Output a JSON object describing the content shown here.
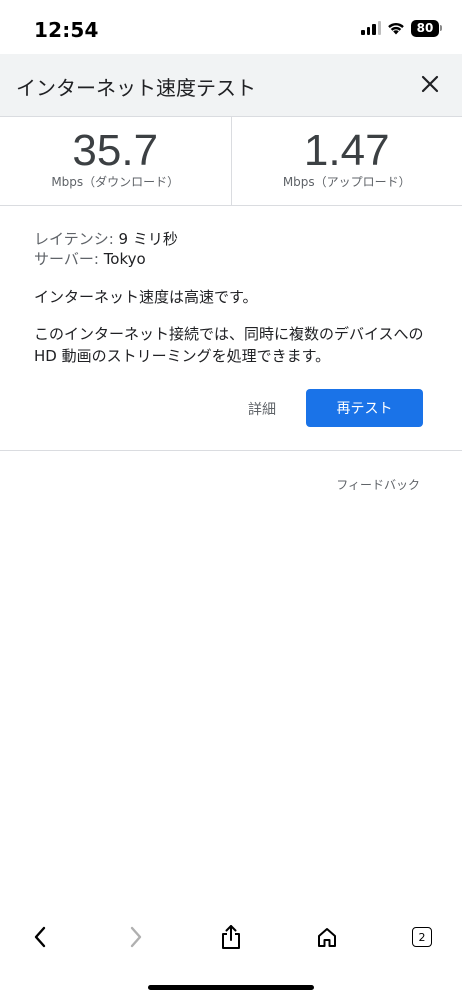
{
  "status_bar": {
    "time": "12:54",
    "battery": "80"
  },
  "header": {
    "title": "インターネット速度テスト",
    "close_icon": "close-icon"
  },
  "speed": {
    "download": {
      "value": "35.7",
      "label": "Mbps（ダウンロード）"
    },
    "upload": {
      "value": "1.47",
      "label": "Mbps（アップロード）"
    }
  },
  "info": {
    "latency_label": "レイテンシ:",
    "latency_value": "9 ミリ秒",
    "server_label": "サーバー:",
    "server_value": "Tokyo",
    "status": "インターネット速度は高速です。",
    "description": "このインターネット接続では、同時に複数のデバイスへの HD 動画のストリーミングを処理できます。"
  },
  "actions": {
    "details_label": "詳細",
    "retest_label": "再テスト"
  },
  "feedback_label": "フィードバック",
  "toolbar": {
    "tab_count": "2",
    "icons": [
      "back-icon",
      "forward-icon",
      "share-icon",
      "home-icon",
      "tabs-icon"
    ]
  },
  "colors": {
    "accent": "#1a73e8",
    "header_bg": "#f1f3f4",
    "divider": "#dadce0"
  }
}
